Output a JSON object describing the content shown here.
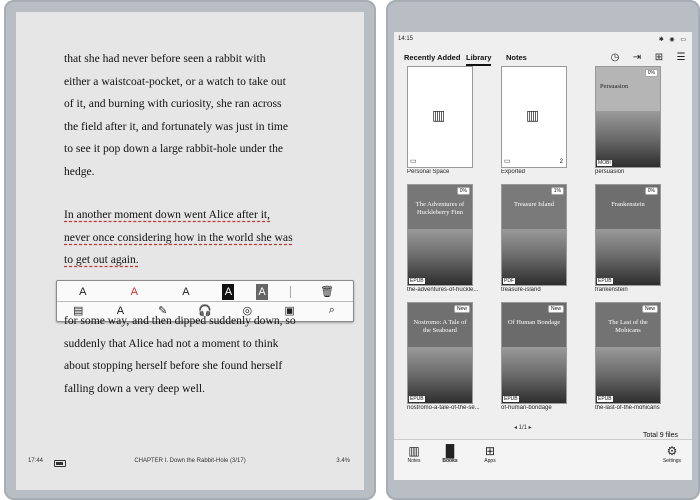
{
  "reader": {
    "para1": [
      "that she had never before seen a rabbit with",
      "either a waistcoat-pocket, or a watch to take out",
      "of it, and burning with curiosity, she ran across",
      "the field after it, and fortunately was just in time",
      "to see it pop down a large rabbit-hole under the",
      "hedge."
    ],
    "para2": [
      "In another moment down went Alice after it,",
      "never once considering how in the world she was",
      "to get out again."
    ],
    "para3": [
      "for some way, and then dipped suddenly down, so",
      "suddenly that Alice had not a moment to think",
      "about stopping herself before she found herself",
      "falling down a very deep well."
    ],
    "toolbar": {
      "row1": [
        "A",
        "A",
        "A",
        "A",
        "A",
        "🗑"
      ],
      "row2": [
        "▤",
        "A",
        "✎",
        "🎧",
        "◎",
        "▣",
        "⌕"
      ]
    },
    "status": {
      "time": "17:44",
      "chapter": "CHAPTER I. Down the Rabbit-Hole (3/17)",
      "percent": "3.4%"
    }
  },
  "library": {
    "time": "14:15",
    "status_icons": "✱ ◉ ▭",
    "tabs": [
      "Recently Added",
      "Library",
      "Notes"
    ],
    "active_tab": "Library",
    "header_icons": [
      "clock-icon",
      "export-icon",
      "grid-icon",
      "menu-icon"
    ],
    "items": [
      {
        "caption": "Personal Space",
        "kind": "folder"
      },
      {
        "caption": "Exported",
        "kind": "folder",
        "count": "2"
      },
      {
        "caption": "persuasion",
        "kind": "book",
        "title": "Persuasion",
        "format": "MOBI",
        "badge": "0%"
      },
      {
        "caption": "the-adventures-of-huckle...",
        "kind": "book",
        "title": "The Adventures of Huckleberry Finn",
        "format": "EPUB",
        "badge": "0%"
      },
      {
        "caption": "treasure-island",
        "kind": "book",
        "title": "Treasure Island",
        "format": "PDF",
        "badge": "1%"
      },
      {
        "caption": "frankenstein",
        "kind": "book",
        "title": "Frankenstein",
        "format": "EPUB",
        "badge": "0%"
      },
      {
        "caption": "nostromo-a-tale-of-the-se...",
        "kind": "book",
        "title": "Nostromo: A Tale of the Seaboard",
        "format": "EPUB",
        "badge": "New"
      },
      {
        "caption": "of-human-bondage",
        "kind": "book",
        "title": "Of Human Bondage",
        "format": "EPUB",
        "badge": "New"
      },
      {
        "caption": "the-last-of-the-mohicans",
        "kind": "book",
        "title": "The Last of the Mohicans",
        "format": "EPUB",
        "badge": "New"
      }
    ],
    "pager": "◂  1/1  ▸",
    "total": "Total 9 files",
    "nav": [
      {
        "label": "Notes",
        "glyph": "▥"
      },
      {
        "label": "Books",
        "glyph": "▐▌"
      },
      {
        "label": "Apps",
        "glyph": "⊞"
      },
      {
        "label": "Settings",
        "glyph": "⚙"
      }
    ]
  }
}
